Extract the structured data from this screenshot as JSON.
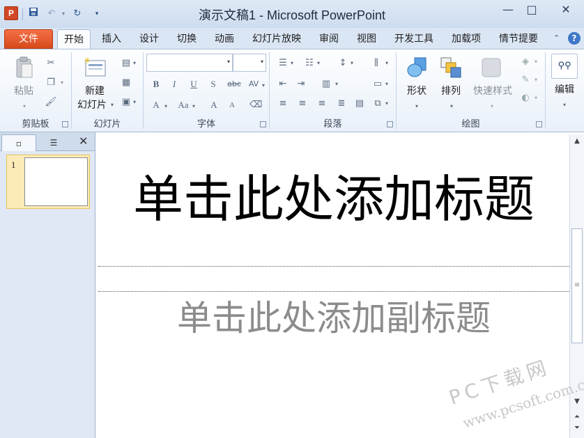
{
  "titlebar": {
    "app_letter": "P",
    "title": "演示文稿1 - Microsoft PowerPoint",
    "qat": {
      "save_icon": "save-icon",
      "undo_icon": "undo-icon",
      "redo_icon": "redo-icon",
      "customize_icon": "customize-qat-icon"
    },
    "window": {
      "minimize": "—",
      "maximize": "□",
      "close": "✕"
    }
  },
  "tabs": {
    "file": "文件",
    "items": [
      "开始",
      "插入",
      "设计",
      "切换",
      "动画",
      "幻灯片放映",
      "审阅",
      "视图",
      "开发工具",
      "加载项",
      "情节提要"
    ],
    "active_index": 0
  },
  "ribbon": {
    "clipboard": {
      "label": "剪贴板",
      "paste": "粘贴"
    },
    "slides": {
      "label": "幻灯片",
      "new_slide_line1": "新建",
      "new_slide_line2": "幻灯片"
    },
    "font": {
      "label": "字体",
      "font_name": "",
      "font_size": "",
      "bold": "B",
      "italic": "I",
      "underline": "U",
      "shadow": "S",
      "strike": "abc",
      "spacing": "AV",
      "font_color": "A",
      "change_case": "Aa",
      "grow": "A",
      "shrink": "A"
    },
    "paragraph": {
      "label": "段落"
    },
    "drawing": {
      "label": "绘图",
      "shapes": "形状",
      "arrange": "排列",
      "quick_styles": "快速样式"
    },
    "editing": {
      "label": "编辑",
      "icon_text": "ﾊﾞ"
    }
  },
  "left_panel": {
    "slide_number": "1"
  },
  "slide": {
    "title_placeholder": "单击此处添加标题",
    "subtitle_placeholder": "单击此处添加副标题"
  },
  "watermark": {
    "line1": "PC下载网",
    "line2": "www.pcsoft.com.cn"
  },
  "colors": {
    "file_tab": "#d64a1c",
    "title_bar": "#dfe9f6",
    "thumb_selected": "#fcebb7"
  }
}
